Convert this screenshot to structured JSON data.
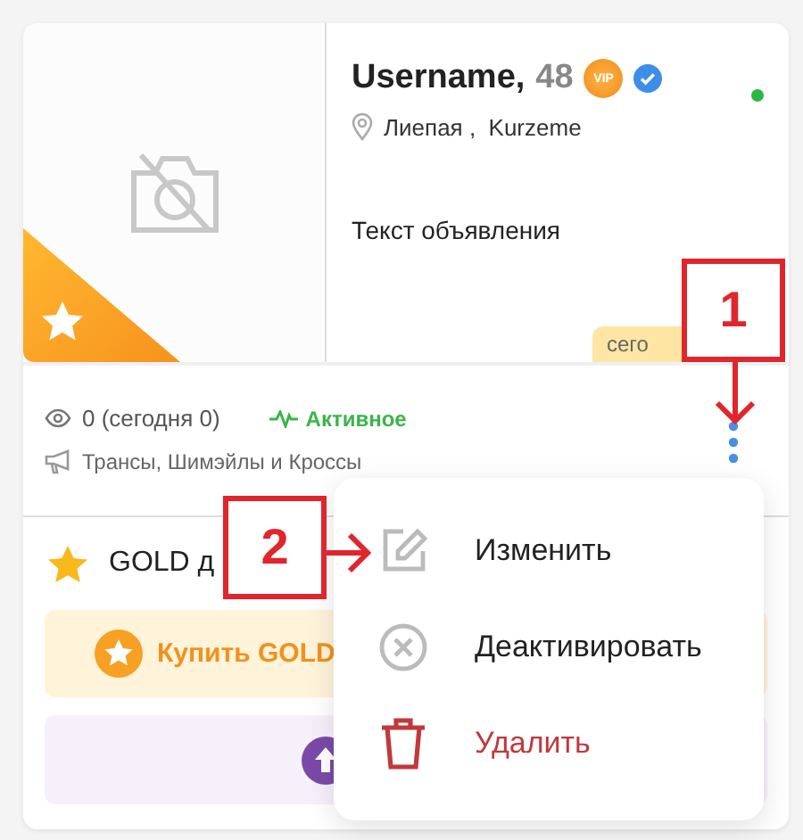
{
  "listing": {
    "username": "Username,",
    "age": "48",
    "vip_badge": "VIP",
    "verified": true,
    "online": true,
    "location": "Лиепая ,  Kurzeme",
    "text": "Текст объявления",
    "date_tag": "сего",
    "featured": true
  },
  "stats": {
    "views": "0 (сегодня 0)",
    "status": "Активное",
    "category": "Трансы, Шимэйлы и Кроссы"
  },
  "gold": {
    "title": "GOLD д",
    "buy_button": "Купить GOLD"
  },
  "menu": [
    {
      "kind": "edit",
      "label": "Изменить"
    },
    {
      "kind": "deactivate",
      "label": "Деактивировать"
    },
    {
      "kind": "delete",
      "label": "Удалить"
    }
  ],
  "annotations": [
    "1",
    "2"
  ]
}
